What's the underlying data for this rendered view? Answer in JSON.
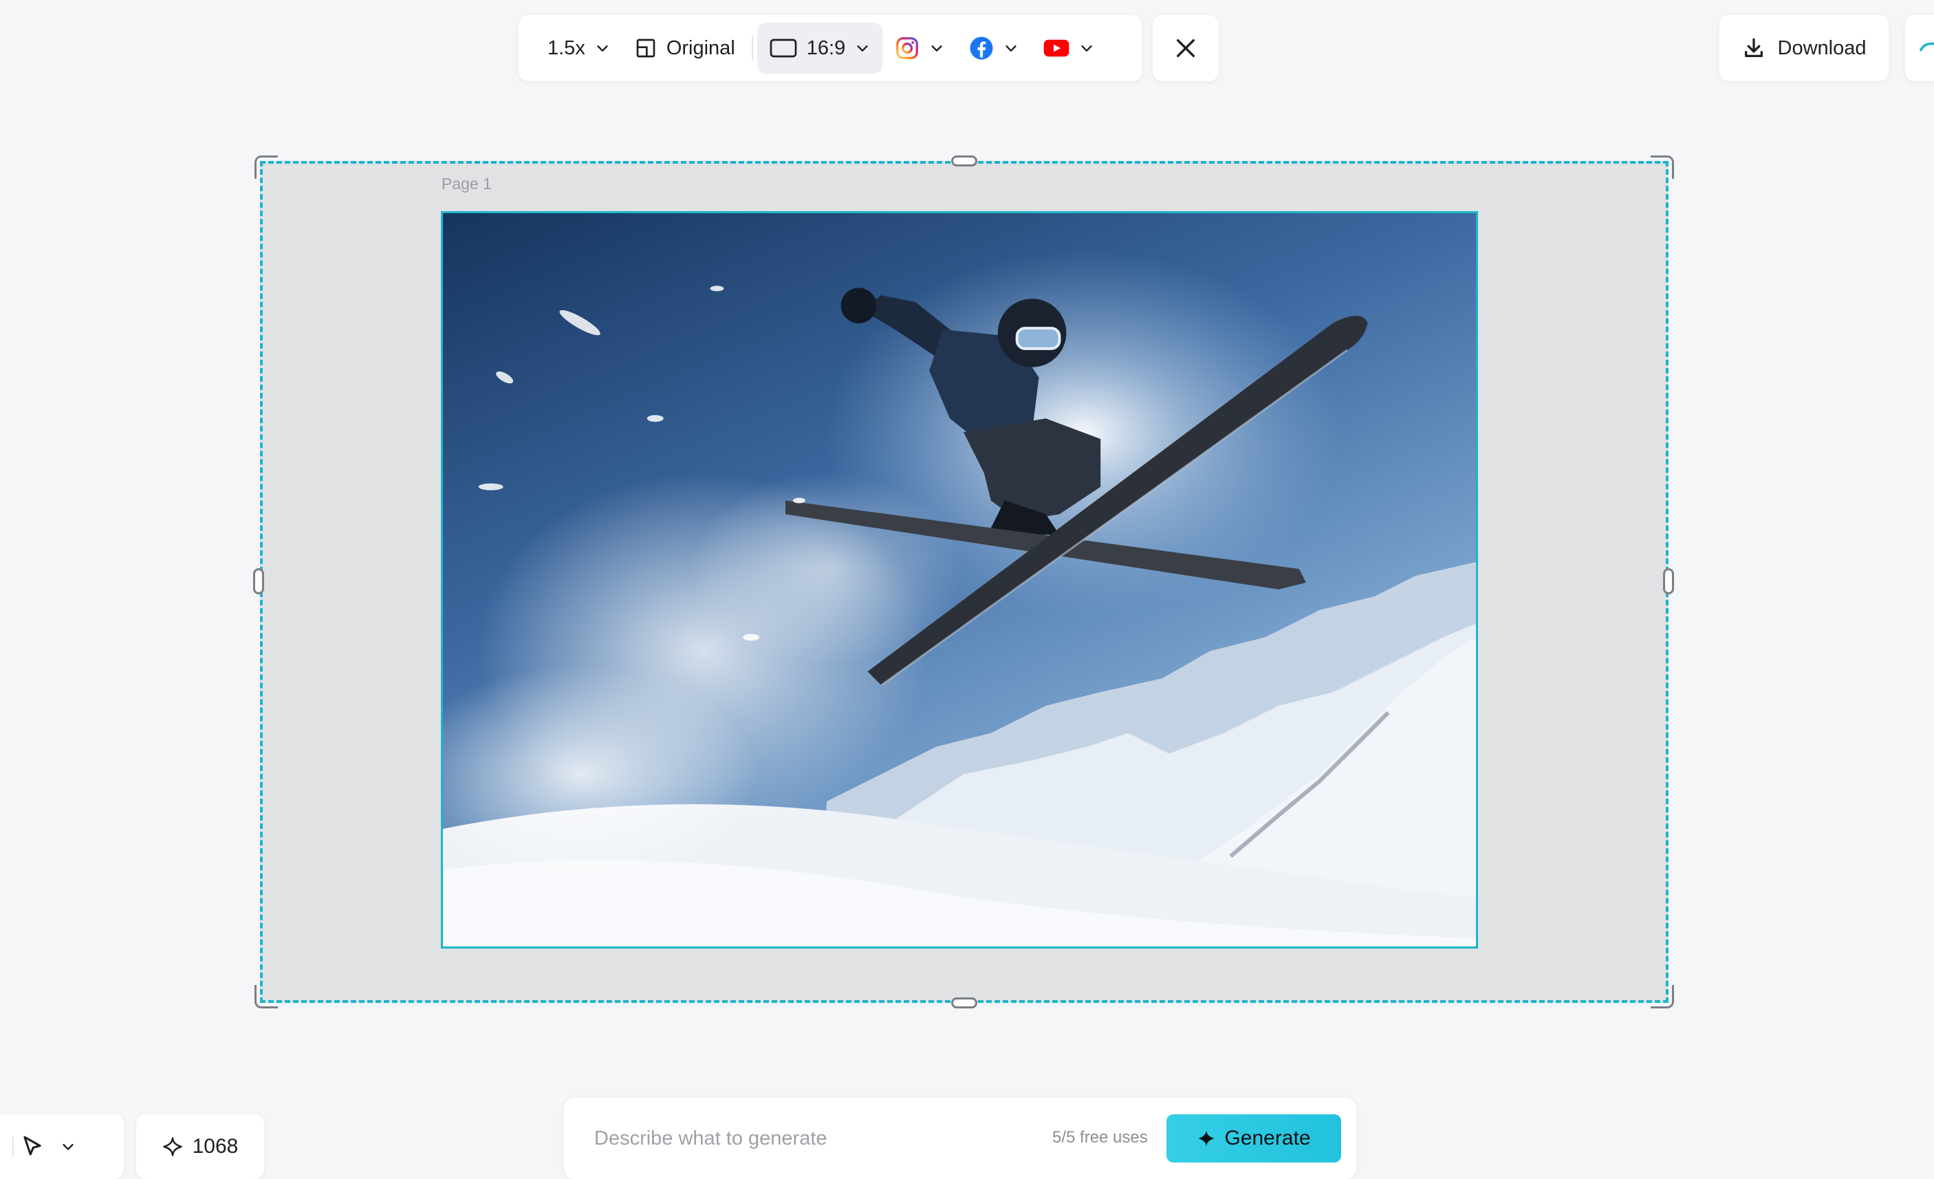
{
  "toolbar": {
    "zoom_label": "1.5x",
    "original_label": "Original",
    "ratio_label": "16:9",
    "icons": [
      "chevron-down-icon",
      "layout-icon",
      "aspect-ratio-icon",
      "instagram-icon",
      "facebook-icon",
      "youtube-icon",
      "close-icon"
    ],
    "colors": {
      "instagram": "#d62976",
      "facebook": "#1877f2",
      "youtube": "#ff0000"
    }
  },
  "download": {
    "label": "Download"
  },
  "canvas": {
    "page_label": "Page 1"
  },
  "bottom": {
    "credits_value": "1068",
    "generate": {
      "placeholder": "Describe what to generate",
      "free_uses": "5/5 free uses",
      "button_label": "Generate"
    }
  },
  "colors": {
    "accent": "#1cb5c8",
    "generate_button": "#35cfe6",
    "canvas_bg": "#e1e2e4",
    "page_bg": "#f5f6f8"
  }
}
